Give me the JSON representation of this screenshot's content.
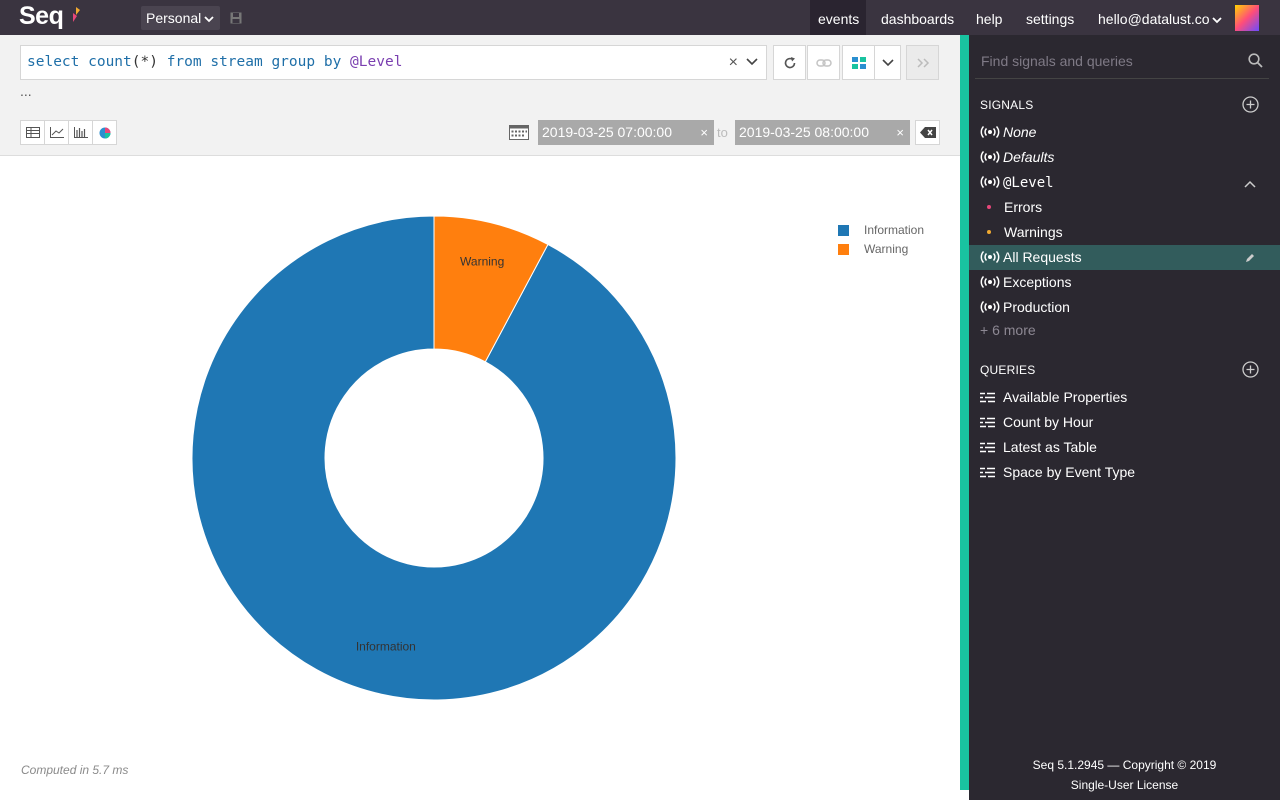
{
  "topbar": {
    "logo": "Seq",
    "workspace": "Personal",
    "nav": {
      "events": "events",
      "dashboards": "dashboards",
      "help": "help",
      "settings": "settings",
      "user": "hello@datalust.co"
    }
  },
  "query": {
    "text_parts": [
      {
        "t": "select ",
        "c": "kw"
      },
      {
        "t": "count",
        "c": "fn"
      },
      {
        "t": "(*) ",
        "c": "pn"
      },
      {
        "t": "from ",
        "c": "kw"
      },
      {
        "t": "stream ",
        "c": "kw"
      },
      {
        "t": "group ",
        "c": "kw"
      },
      {
        "t": "by ",
        "c": "kw"
      },
      {
        "t": "@Level",
        "c": "prop"
      }
    ],
    "clear": "×",
    "ellipsis": "..."
  },
  "range": {
    "from": "2019-03-25 07:00:00",
    "to_label": "to",
    "to": "2019-03-25 08:00:00",
    "clear": "×"
  },
  "chart_data": {
    "type": "pie",
    "categories": [
      "Information",
      "Warning"
    ],
    "values": [
      92.2,
      7.8
    ],
    "colors": [
      "#1f77b4",
      "#ff7f0e"
    ],
    "donut": true,
    "legend": "top-right"
  },
  "computed": "Computed in 5.7 ms",
  "sidebar": {
    "search_placeholder": "Find signals and queries",
    "signals_title": "SIGNALS",
    "signals": [
      {
        "label": "None",
        "style": "italic"
      },
      {
        "label": "Defaults",
        "style": "italic"
      },
      {
        "label": "@Level",
        "style": "mono"
      },
      {
        "label": "Errors",
        "dot": "#e8477a"
      },
      {
        "label": "Warnings",
        "dot": "#f0a930"
      },
      {
        "label": "All Requests",
        "active": true
      },
      {
        "label": "Exceptions"
      },
      {
        "label": "Production"
      }
    ],
    "more": "+ 6 more",
    "queries_title": "QUERIES",
    "queries": [
      "Available Properties",
      "Count by Hour",
      "Latest as Table",
      "Space by Event Type"
    ],
    "footer_line1": "Seq 5.1.2945 — Copyright © 2019",
    "footer_line2": "Single-User License"
  },
  "colors": {
    "accent": "#19c3a0",
    "sidebar_bg": "#2b2830",
    "topbar_bg": "#3a3440"
  }
}
